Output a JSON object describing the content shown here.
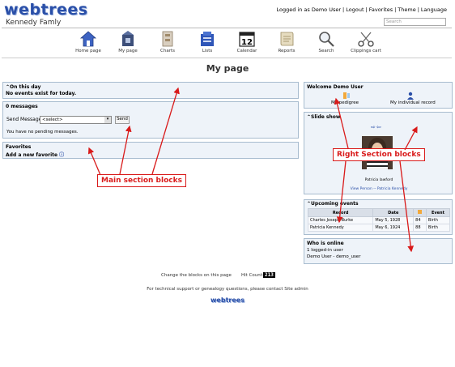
{
  "header": {
    "logo": "webtrees",
    "tree_name": "Kennedy Famly",
    "links": [
      "Logged in as Demo User",
      "Logout",
      "Favorites",
      "Theme",
      "Language"
    ],
    "search_placeholder": "Search"
  },
  "menu": [
    {
      "label": "Home page",
      "icon": "home-icon"
    },
    {
      "label": "My page",
      "icon": "mypage-icon"
    },
    {
      "label": "Charts",
      "icon": "charts-icon"
    },
    {
      "label": "Lists",
      "icon": "lists-icon"
    },
    {
      "label": "Calendar",
      "icon": "calendar-icon",
      "day": "12"
    },
    {
      "label": "Reports",
      "icon": "reports-icon"
    },
    {
      "label": "Search",
      "icon": "search-icon"
    },
    {
      "label": "Clippings cart",
      "icon": "scissors-icon"
    }
  ],
  "page_title": "My page",
  "main_blocks": {
    "on_this_day": {
      "title": "On this day",
      "text": "No events exist for today."
    },
    "messages": {
      "title": "0 messages",
      "send_label": "Send Message",
      "select_value": "<select>",
      "send_button": "Send",
      "pending": "You have no pending messages."
    },
    "favorites": {
      "title": "Favorites",
      "add": "Add a new favorite"
    }
  },
  "right_blocks": {
    "welcome": {
      "title": "Welcome Demo User",
      "pedigree": "My pedigree",
      "record": "My individual record"
    },
    "slideshow": {
      "title": "Slide show",
      "caption": "Patricia lawford",
      "view": "View Person -- Patricia Kennedy"
    },
    "upcoming": {
      "title": "Upcoming events",
      "headers": [
        "Record",
        "Date",
        "",
        "Event"
      ],
      "rows": [
        [
          "Charles Joseph Burke",
          "May 5, 1928",
          "84",
          "Birth"
        ],
        [
          "Patricia Kennedy",
          "May 6, 1924",
          "88",
          "Birth"
        ]
      ]
    },
    "who_online": {
      "title": "Who is online",
      "count": "1 logged-in user",
      "user": "Demo User - demo_user"
    }
  },
  "annotations": {
    "main": "Main section blocks",
    "right": "Right Section blocks"
  },
  "footer": {
    "change_blocks": "Change the blocks on this page",
    "hit_label": "Hit Count:",
    "hit_count": "213",
    "support": "For technical support or genealogy questions, please contact Site admin",
    "logo": "webtrees"
  },
  "colors": {
    "accent": "#2a4fa8",
    "block_bg": "#eef3f9",
    "block_border": "#a8bccf",
    "annotation": "#d91a1a"
  }
}
